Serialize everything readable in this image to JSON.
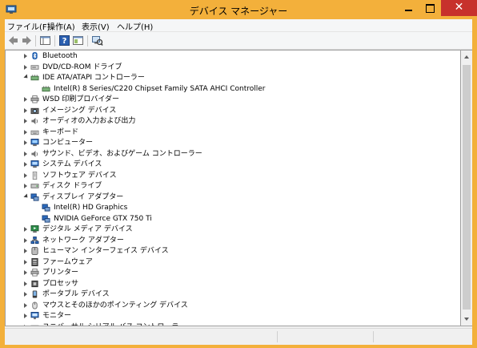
{
  "window": {
    "title": "デバイス マネージャー",
    "close_glyph": "✕"
  },
  "menu": [
    {
      "label": "ファイル(F)",
      "name": "menu-file"
    },
    {
      "label": "操作(A)",
      "name": "menu-action"
    },
    {
      "label": "表示(V)",
      "name": "menu-view"
    },
    {
      "label": "ヘルプ(H)",
      "name": "menu-help"
    }
  ],
  "tree": [
    {
      "label": "Bluetooth",
      "level": 0,
      "expander": "closed",
      "icon": "bluetooth-icon"
    },
    {
      "label": "DVD/CD-ROM ドライブ",
      "level": 0,
      "expander": "closed",
      "icon": "dvd-drive-icon"
    },
    {
      "label": "IDE ATA/ATAPI コントローラー",
      "level": 0,
      "expander": "open",
      "icon": "ide-controller-icon"
    },
    {
      "label": "Intel(R) 8 Series/C220 Chipset Family SATA AHCI Controller",
      "level": 1,
      "expander": "none",
      "icon": "ide-controller-icon"
    },
    {
      "label": "WSD 印刷プロバイダー",
      "level": 0,
      "expander": "closed",
      "icon": "printer-icon"
    },
    {
      "label": "イメージング デバイス",
      "level": 0,
      "expander": "closed",
      "icon": "camera-icon"
    },
    {
      "label": "オーディオの入力および出力",
      "level": 0,
      "expander": "closed",
      "icon": "speaker-icon"
    },
    {
      "label": "キーボード",
      "level": 0,
      "expander": "closed",
      "icon": "keyboard-icon"
    },
    {
      "label": "コンピューター",
      "level": 0,
      "expander": "closed",
      "icon": "computer-icon"
    },
    {
      "label": "サウンド、ビデオ、およびゲーム コントローラー",
      "level": 0,
      "expander": "closed",
      "icon": "speaker-icon"
    },
    {
      "label": "システム デバイス",
      "level": 0,
      "expander": "closed",
      "icon": "system-device-icon"
    },
    {
      "label": "ソフトウェア デバイス",
      "level": 0,
      "expander": "closed",
      "icon": "software-device-icon"
    },
    {
      "label": "ディスク ドライブ",
      "level": 0,
      "expander": "closed",
      "icon": "disk-drive-icon"
    },
    {
      "label": "ディスプレイ アダプター",
      "level": 0,
      "expander": "open",
      "icon": "display-adapter-icon"
    },
    {
      "label": "Intel(R) HD Graphics",
      "level": 1,
      "expander": "none",
      "icon": "display-adapter-icon"
    },
    {
      "label": "NVIDIA GeForce GTX 750 Ti",
      "level": 1,
      "expander": "none",
      "icon": "display-adapter-icon"
    },
    {
      "label": "デジタル メディア デバイス",
      "level": 0,
      "expander": "closed",
      "icon": "media-device-icon"
    },
    {
      "label": "ネットワーク アダプター",
      "level": 0,
      "expander": "closed",
      "icon": "network-adapter-icon"
    },
    {
      "label": "ヒューマン インターフェイス デバイス",
      "level": 0,
      "expander": "closed",
      "icon": "hid-icon"
    },
    {
      "label": "ファームウェア",
      "level": 0,
      "expander": "closed",
      "icon": "firmware-icon"
    },
    {
      "label": "プリンター",
      "level": 0,
      "expander": "closed",
      "icon": "printer-icon"
    },
    {
      "label": "プロセッサ",
      "level": 0,
      "expander": "closed",
      "icon": "processor-icon"
    },
    {
      "label": "ポータブル デバイス",
      "level": 0,
      "expander": "closed",
      "icon": "portable-device-icon"
    },
    {
      "label": "マウスとそのほかのポインティング デバイス",
      "level": 0,
      "expander": "closed",
      "icon": "mouse-icon"
    },
    {
      "label": "モニター",
      "level": 0,
      "expander": "closed",
      "icon": "monitor-icon"
    },
    {
      "label": "ユニバーサル シリアル バス コントローラー",
      "level": 0,
      "expander": "closed",
      "icon": "usb-icon"
    }
  ]
}
